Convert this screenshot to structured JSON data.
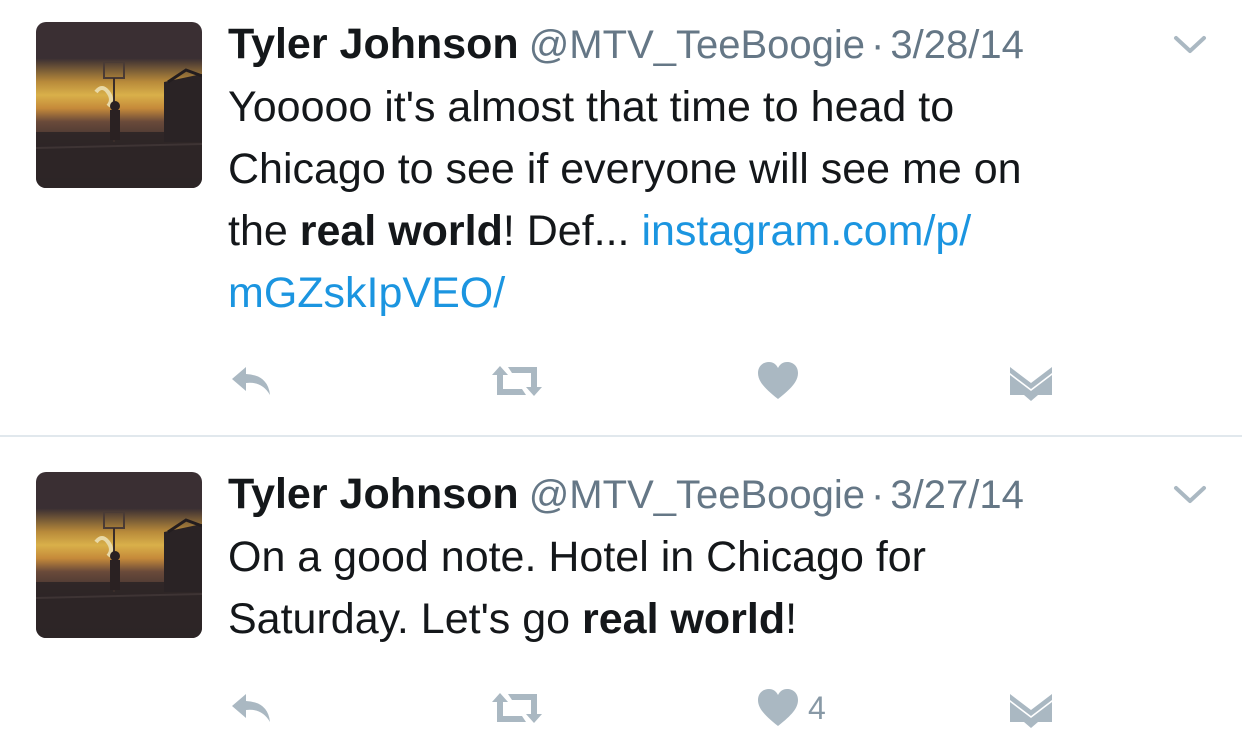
{
  "colors": {
    "text": "#14171a",
    "secondary": "#657786",
    "link": "#1b95e0",
    "icon": "#aab8c2",
    "divider": "#e1e8ed"
  },
  "icons": {
    "reply": "reply-arrow-icon",
    "retweet": "retweet-icon",
    "like": "heart-icon",
    "message": "envelope-icon",
    "menu": "chevron-down-icon"
  },
  "tweets": [
    {
      "name": "Tyler Johnson",
      "handle": "@MTV_TeeBoogie",
      "separator": "·",
      "date": "3/28/14",
      "text": {
        "l1": "Yooooo it's almost that time to head to",
        "l2": "Chicago to see if everyone will see me on",
        "l3_pre": "the ",
        "l3_bold": "real world",
        "l3_post": "! Def... ",
        "l3_link": "instagram.com/p/",
        "l4_link": "mGZskIpVEO/"
      },
      "like_count": ""
    },
    {
      "name": "Tyler Johnson",
      "handle": "@MTV_TeeBoogie",
      "separator": "·",
      "date": "3/27/14",
      "text": {
        "l1": "On a good note. Hotel in Chicago for",
        "l2_pre": "Saturday. Let's go ",
        "l2_bold": "real world",
        "l2_post": "!"
      },
      "like_count": "4"
    }
  ]
}
